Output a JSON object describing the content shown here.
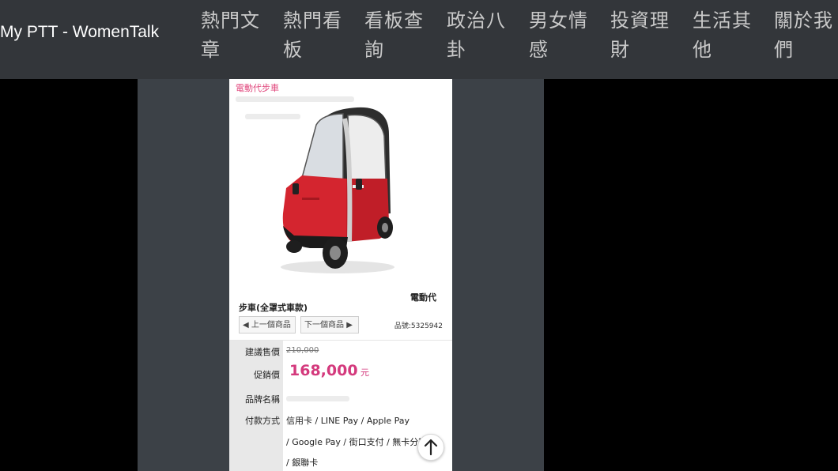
{
  "site": {
    "brand": "My PTT - WomenTalk"
  },
  "nav": {
    "items": [
      {
        "label": "熱門文章"
      },
      {
        "label": "熱門看板"
      },
      {
        "label": "看板查詢"
      },
      {
        "label": "政治八卦"
      },
      {
        "label": "男女情感"
      },
      {
        "label": "投資理財"
      },
      {
        "label": "生活其他"
      },
      {
        "label": "關於我們"
      }
    ]
  },
  "product": {
    "category": "電動代步車",
    "title_part1": "電動代",
    "title_part2": "步車(全罩式車款)",
    "prev_label": "上一個商品",
    "next_label": "下一個商品",
    "sku": "品號:5325942",
    "car_color": "#d4252f"
  },
  "specs": {
    "msrp_label": "建議售價",
    "msrp_value": "210,000",
    "sale_label": "促銷價",
    "sale_value": "168,000",
    "sale_unit": "元",
    "brand_label": "品牌名稱",
    "brand_value": "",
    "payment_label": "付款方式",
    "payment_line1": "信用卡 / LINE Pay / Apple Pay",
    "payment_line2": "/ Google Pay / 街口支付 / 無卡分期",
    "payment_line3": "/ 銀聯卡"
  },
  "controls": {
    "scroll_top_icon": "arrow-up-icon"
  }
}
